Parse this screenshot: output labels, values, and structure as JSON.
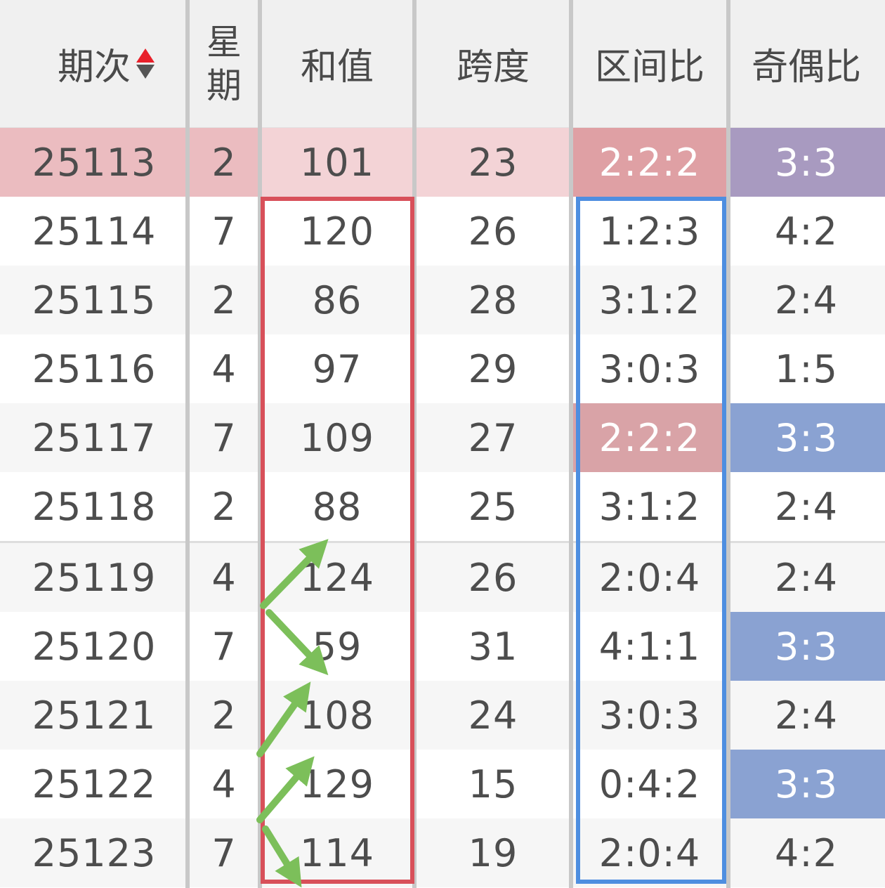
{
  "header": {
    "period": "期次",
    "weekday_line1": "星",
    "weekday_line2": "期",
    "sum": "和值",
    "span": "跨度",
    "zone_ratio": "区间比",
    "odd_even_ratio": "奇偶比"
  },
  "rows": [
    {
      "period": "25113",
      "weekday": "2",
      "sum": "101",
      "span": "23",
      "zone": "2:2:2",
      "odd_even": "3:3"
    },
    {
      "period": "25114",
      "weekday": "7",
      "sum": "120",
      "span": "26",
      "zone": "1:2:3",
      "odd_even": "4:2"
    },
    {
      "period": "25115",
      "weekday": "2",
      "sum": "86",
      "span": "28",
      "zone": "3:1:2",
      "odd_even": "2:4"
    },
    {
      "period": "25116",
      "weekday": "4",
      "sum": "97",
      "span": "29",
      "zone": "3:0:3",
      "odd_even": "1:5"
    },
    {
      "period": "25117",
      "weekday": "7",
      "sum": "109",
      "span": "27",
      "zone": "2:2:2",
      "odd_even": "3:3"
    },
    {
      "period": "25118",
      "weekday": "2",
      "sum": "88",
      "span": "25",
      "zone": "3:1:2",
      "odd_even": "2:4"
    },
    {
      "period": "25119",
      "weekday": "4",
      "sum": "124",
      "span": "26",
      "zone": "2:0:4",
      "odd_even": "2:4"
    },
    {
      "period": "25120",
      "weekday": "7",
      "sum": "59",
      "span": "31",
      "zone": "4:1:1",
      "odd_even": "3:3"
    },
    {
      "period": "25121",
      "weekday": "2",
      "sum": "108",
      "span": "24",
      "zone": "3:0:3",
      "odd_even": "2:4"
    },
    {
      "period": "25122",
      "weekday": "4",
      "sum": "129",
      "span": "15",
      "zone": "0:4:2",
      "odd_even": "3:3"
    },
    {
      "period": "25123",
      "weekday": "7",
      "sum": "114",
      "span": "19",
      "zone": "2:0:4",
      "odd_even": "4:2"
    }
  ],
  "colors": {
    "red_box": "#d8505a",
    "blue_box": "#4e8ee0",
    "arrow": "#7cbf5a",
    "zone_highlight": "#dfa0a4",
    "odd_even_highlight": "#8aa2d2"
  }
}
